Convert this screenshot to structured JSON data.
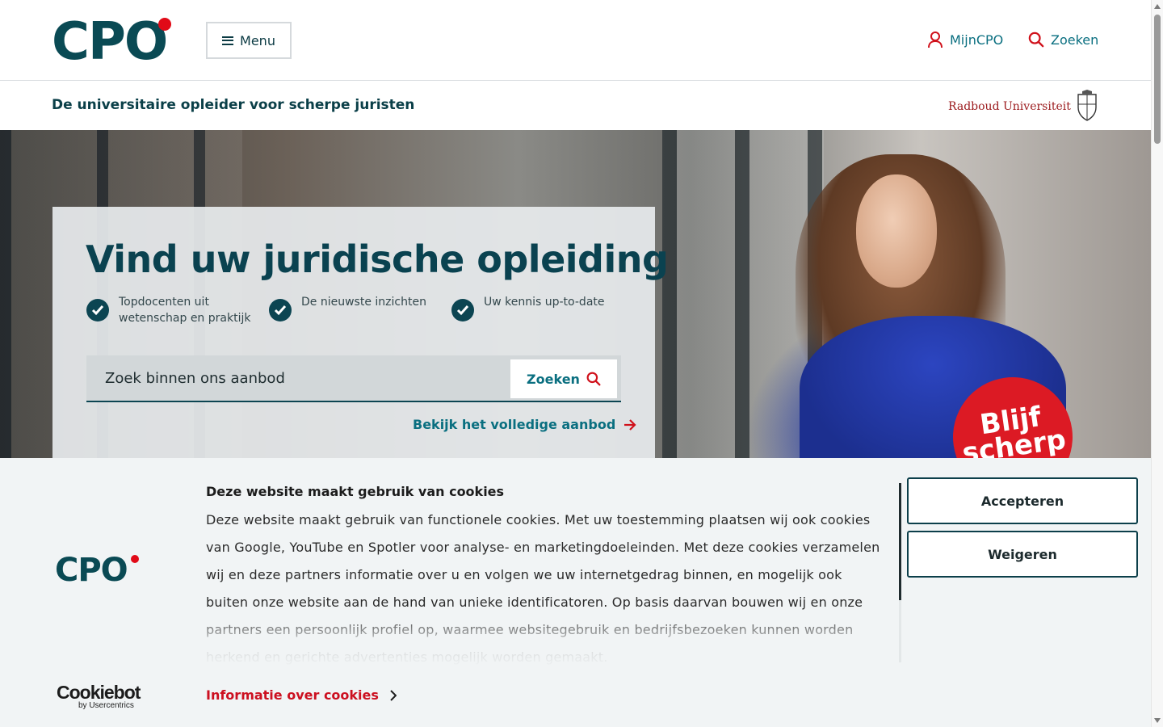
{
  "header": {
    "logo_text": "CPO",
    "menu_label": "Menu",
    "account_label": "MijnCPO",
    "search_label": "Zoeken",
    "tagline": "De universitaire opleider voor scherpe juristen",
    "partner": "Radboud Universiteit"
  },
  "hero": {
    "title": "Vind uw juridische opleiding",
    "usps": [
      {
        "line1": "Topdocenten uit",
        "line2": "wetenschap en praktijk"
      },
      {
        "line1": "De nieuwste inzichten",
        "line2": ""
      },
      {
        "line1": "Uw kennis up-to-date",
        "line2": ""
      }
    ],
    "search_placeholder": "Zoek binnen ons aanbod",
    "search_button": "Zoeken",
    "all_offer_link": "Bekijk het volledige aanbod",
    "badge_line1": "Blijf",
    "badge_line2": "scherp"
  },
  "cookie": {
    "logo_text": "CPO",
    "title": "Deze website maakt gebruik van cookies",
    "body": "Deze website maakt gebruik van functionele cookies. Met uw toestemming plaatsen wij ook cookies van Google, YouTube en Spotler voor analyse- en marketingdoeleinden. Met deze cookies verzamelen wij en deze partners informatie over u en volgen we uw internetgedrag binnen, en mogelijk ook buiten onze website aan de hand van unieke identificatoren. Op basis daarvan bouwen wij en onze partners een persoonlijk profiel op, waarmee websitegebruik en bedrijfsbezoeken kunnen worden herkend en gerichte advertenties mogelijk worden gemaakt.",
    "accept": "Accepteren",
    "decline": "Weigeren",
    "info_link": "Informatie over cookies",
    "provider": "Cookiebot",
    "provider_sub": "by Usercentrics"
  },
  "colors": {
    "brand_teal": "#0a4a54",
    "brand_red": "#e10a17",
    "link": "#0a6f80"
  }
}
